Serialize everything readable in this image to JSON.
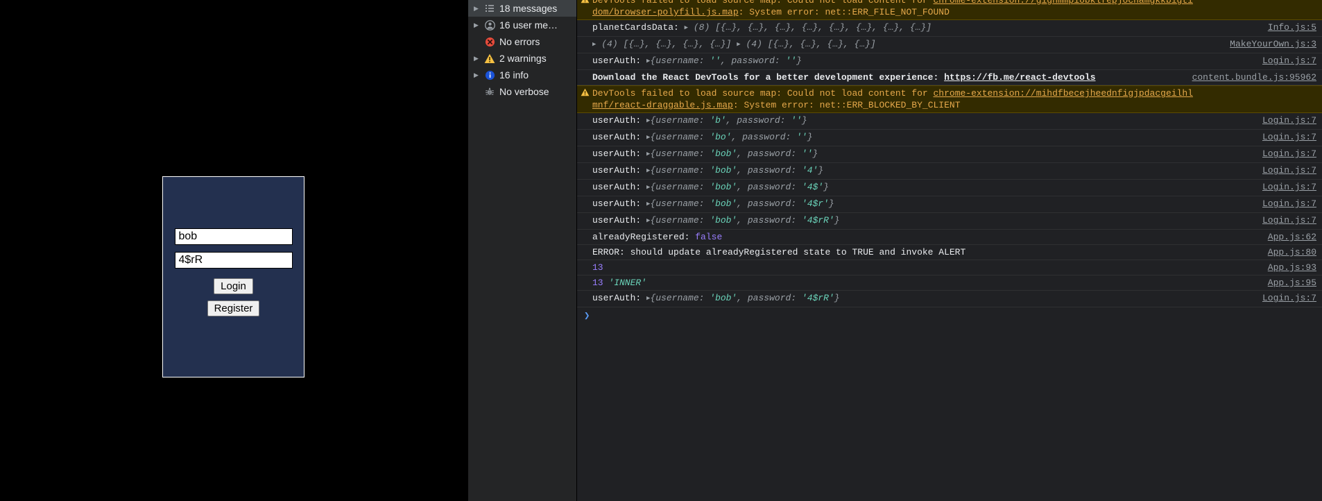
{
  "webpage": {
    "login_form": {
      "username_value": "bob",
      "username_placeholder": "",
      "password_value": "4$rR",
      "password_placeholder": "",
      "login_label": "Login",
      "register_label": "Register"
    },
    "background": "#000000",
    "card_background": "#23304f"
  },
  "devtools": {
    "sidebar": {
      "items": [
        {
          "label": "18 messages",
          "icon": "list-icon",
          "selected": true,
          "expandable": true
        },
        {
          "label": "16 user me…",
          "icon": "user-icon",
          "selected": false,
          "expandable": true
        },
        {
          "label": "No errors",
          "icon": "error-icon",
          "selected": false,
          "expandable": false
        },
        {
          "label": "2 warnings",
          "icon": "warning-icon",
          "selected": false,
          "expandable": true
        },
        {
          "label": "16 info",
          "icon": "info-icon",
          "selected": false,
          "expandable": true
        },
        {
          "label": "No verbose",
          "icon": "bug-icon",
          "selected": false,
          "expandable": false
        }
      ]
    },
    "console": {
      "prompt_symbol": "❯",
      "rows": [
        {
          "type": "warning",
          "source": "",
          "segments": [
            {
              "t": "DevTools failed to load source map: Could not load content for ",
              "c": "warn"
            },
            {
              "t": "chrome-extension://gighmmpiobklfepjocnamgkkbigtidom/browser-polyfill.js.map",
              "c": "link"
            },
            {
              "t": ": System error: net::ERR_FILE_NOT_FOUND",
              "c": "warn"
            }
          ]
        },
        {
          "type": "log",
          "source": "Info.js:5",
          "segments": [
            {
              "t": "planetCardsData: ",
              "c": "plain"
            },
            {
              "t": "▶",
              "c": "arrow"
            },
            {
              "t": " (8) ",
              "c": "obj"
            },
            {
              "t": "[{…}, {…}, {…}, {…}, {…}, {…}, {…}, {…}]",
              "c": "obj"
            }
          ]
        },
        {
          "type": "log",
          "source": "MakeYourOwn.js:3",
          "segments": [
            {
              "t": "▶",
              "c": "arrow"
            },
            {
              "t": " (4) ",
              "c": "obj"
            },
            {
              "t": "[{…}, {…}, {…}, {…}] ",
              "c": "obj"
            },
            {
              "t": "▶",
              "c": "arrow"
            },
            {
              "t": " (4) ",
              "c": "obj"
            },
            {
              "t": "[{…}, {…}, {…}, {…}]",
              "c": "obj"
            }
          ]
        },
        {
          "type": "log",
          "source": "Login.js:7",
          "segments": [
            {
              "t": "userAuth: ",
              "c": "plain"
            },
            {
              "t": "▶",
              "c": "arrow"
            },
            {
              "t": "{username: ",
              "c": "obj"
            },
            {
              "t": "''",
              "c": "str"
            },
            {
              "t": ", password: ",
              "c": "obj"
            },
            {
              "t": "''",
              "c": "str"
            },
            {
              "t": "}",
              "c": "obj"
            }
          ]
        },
        {
          "type": "log-bold",
          "source": "content.bundle.js:95962",
          "segments": [
            {
              "t": "Download the React DevTools for a better development experience: ",
              "c": "white-bold"
            },
            {
              "t": "https://fb.me/react-devtools",
              "c": "link-bold"
            }
          ]
        },
        {
          "type": "warning",
          "source": "",
          "segments": [
            {
              "t": "DevTools failed to load source map: Could not load content for ",
              "c": "warn"
            },
            {
              "t": "chrome-extension://mihdfbecejheednfigjpdacgeilhlmnf/react-draggable.js.map",
              "c": "link"
            },
            {
              "t": ": System error: net::ERR_BLOCKED_BY_CLIENT",
              "c": "warn"
            }
          ]
        },
        {
          "type": "log",
          "source": "Login.js:7",
          "segments": [
            {
              "t": "userAuth: ",
              "c": "plain"
            },
            {
              "t": "▶",
              "c": "arrow"
            },
            {
              "t": "{username: ",
              "c": "obj"
            },
            {
              "t": "'b'",
              "c": "str"
            },
            {
              "t": ", password: ",
              "c": "obj"
            },
            {
              "t": "''",
              "c": "str"
            },
            {
              "t": "}",
              "c": "obj"
            }
          ]
        },
        {
          "type": "log",
          "source": "Login.js:7",
          "segments": [
            {
              "t": "userAuth: ",
              "c": "plain"
            },
            {
              "t": "▶",
              "c": "arrow"
            },
            {
              "t": "{username: ",
              "c": "obj"
            },
            {
              "t": "'bo'",
              "c": "str"
            },
            {
              "t": ", password: ",
              "c": "obj"
            },
            {
              "t": "''",
              "c": "str"
            },
            {
              "t": "}",
              "c": "obj"
            }
          ]
        },
        {
          "type": "log",
          "source": "Login.js:7",
          "segments": [
            {
              "t": "userAuth: ",
              "c": "plain"
            },
            {
              "t": "▶",
              "c": "arrow"
            },
            {
              "t": "{username: ",
              "c": "obj"
            },
            {
              "t": "'bob'",
              "c": "str"
            },
            {
              "t": ", password: ",
              "c": "obj"
            },
            {
              "t": "''",
              "c": "str"
            },
            {
              "t": "}",
              "c": "obj"
            }
          ]
        },
        {
          "type": "log",
          "source": "Login.js:7",
          "segments": [
            {
              "t": "userAuth: ",
              "c": "plain"
            },
            {
              "t": "▶",
              "c": "arrow"
            },
            {
              "t": "{username: ",
              "c": "obj"
            },
            {
              "t": "'bob'",
              "c": "str"
            },
            {
              "t": ", password: ",
              "c": "obj"
            },
            {
              "t": "'4'",
              "c": "str"
            },
            {
              "t": "}",
              "c": "obj"
            }
          ]
        },
        {
          "type": "log",
          "source": "Login.js:7",
          "segments": [
            {
              "t": "userAuth: ",
              "c": "plain"
            },
            {
              "t": "▶",
              "c": "arrow"
            },
            {
              "t": "{username: ",
              "c": "obj"
            },
            {
              "t": "'bob'",
              "c": "str"
            },
            {
              "t": ", password: ",
              "c": "obj"
            },
            {
              "t": "'4$'",
              "c": "str"
            },
            {
              "t": "}",
              "c": "obj"
            }
          ]
        },
        {
          "type": "log",
          "source": "Login.js:7",
          "segments": [
            {
              "t": "userAuth: ",
              "c": "plain"
            },
            {
              "t": "▶",
              "c": "arrow"
            },
            {
              "t": "{username: ",
              "c": "obj"
            },
            {
              "t": "'bob'",
              "c": "str"
            },
            {
              "t": ", password: ",
              "c": "obj"
            },
            {
              "t": "'4$r'",
              "c": "str"
            },
            {
              "t": "}",
              "c": "obj"
            }
          ]
        },
        {
          "type": "log",
          "source": "Login.js:7",
          "segments": [
            {
              "t": "userAuth: ",
              "c": "plain"
            },
            {
              "t": "▶",
              "c": "arrow"
            },
            {
              "t": "{username: ",
              "c": "obj"
            },
            {
              "t": "'bob'",
              "c": "str"
            },
            {
              "t": ", password: ",
              "c": "obj"
            },
            {
              "t": "'4$rR'",
              "c": "str"
            },
            {
              "t": "}",
              "c": "obj"
            }
          ]
        },
        {
          "type": "log",
          "source": "App.js:62",
          "segments": [
            {
              "t": "alreadyRegistered: ",
              "c": "plain"
            },
            {
              "t": "false",
              "c": "bool"
            }
          ]
        },
        {
          "type": "log",
          "source": "App.js:80",
          "segments": [
            {
              "t": "ERROR: should update alreadyRegistered state to TRUE and invoke ALERT",
              "c": "plain"
            }
          ]
        },
        {
          "type": "log",
          "source": "App.js:93",
          "segments": [
            {
              "t": "13",
              "c": "num"
            }
          ]
        },
        {
          "type": "log",
          "source": "App.js:95",
          "segments": [
            {
              "t": "13 ",
              "c": "num"
            },
            {
              "t": "'INNER'",
              "c": "str2"
            }
          ]
        },
        {
          "type": "log",
          "source": "Login.js:7",
          "segments": [
            {
              "t": "userAuth: ",
              "c": "plain"
            },
            {
              "t": "▶",
              "c": "arrow"
            },
            {
              "t": "{username: ",
              "c": "obj"
            },
            {
              "t": "'bob'",
              "c": "str"
            },
            {
              "t": ", password: ",
              "c": "obj"
            },
            {
              "t": "'4$rR'",
              "c": "str"
            },
            {
              "t": "}",
              "c": "obj"
            }
          ]
        }
      ]
    }
  }
}
